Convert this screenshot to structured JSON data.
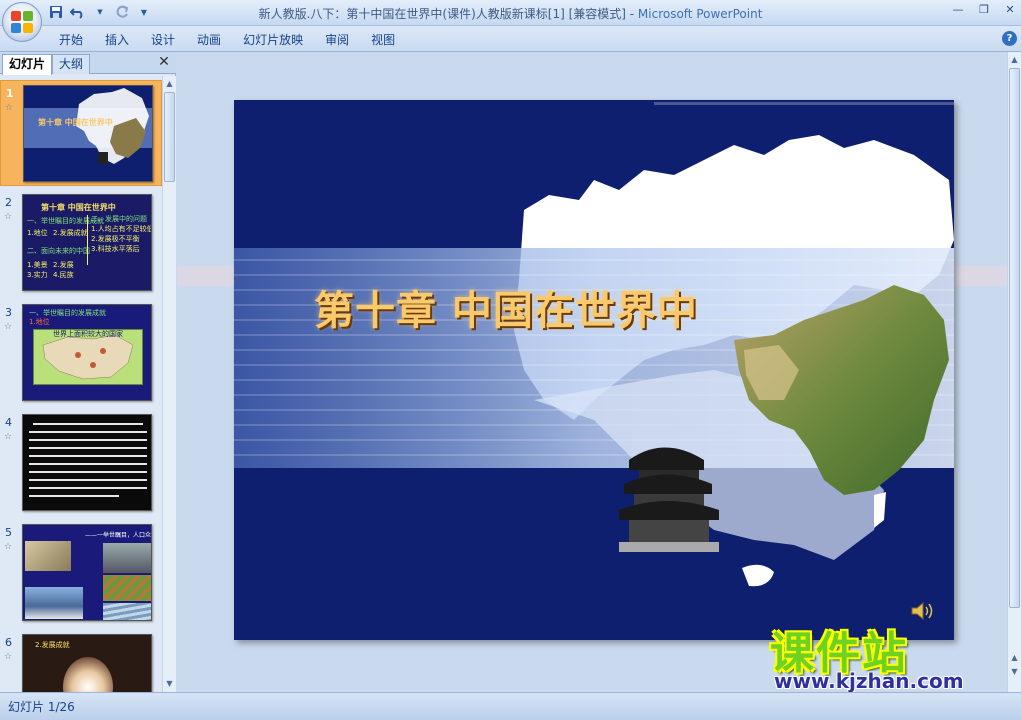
{
  "window": {
    "title": "新人教版.八下：第十中国在世界中(课件)人教版新课标[1] [兼容模式]",
    "separator": " - ",
    "app_name": "Microsoft PowerPoint"
  },
  "quick_access": {
    "icons": [
      "save-icon",
      "undo-icon",
      "redo-icon",
      "customize-icon"
    ]
  },
  "ribbon": {
    "tabs": [
      "开始",
      "插入",
      "设计",
      "动画",
      "幻灯片放映",
      "审阅",
      "视图"
    ]
  },
  "left_pane": {
    "tabs": {
      "slides": "幻灯片",
      "outline": "大纲"
    },
    "slides": [
      {
        "number": "1",
        "star": "☆",
        "selected": true,
        "title": "第十章 中国在世界中"
      },
      {
        "number": "2",
        "star": "☆",
        "selected": false,
        "title": "第十章 中国在世界中",
        "lines": [
          "一、举世瞩目的发展成就",
          "二、发展中的问题",
          "1.地位",
          "2.发展成就",
          "二、面向未来的中国",
          "1.人均占有不足较低",
          "2.发展极不平衡",
          "3.科技水平落后",
          "1.美景",
          "2.发展",
          "3.实力",
          "4.民族"
        ]
      },
      {
        "number": "3",
        "star": "☆",
        "selected": false,
        "title": "一、举世瞩目的发展成就",
        "subtitle": "1.地位",
        "map_title": "世界上面积较大的国家"
      },
      {
        "number": "4",
        "star": "☆",
        "selected": false
      },
      {
        "number": "5",
        "star": "☆",
        "selected": false,
        "caption": "——一举世瞩目，人口众多"
      },
      {
        "number": "6",
        "star": "☆",
        "selected": false,
        "title": "2.发展成就"
      }
    ]
  },
  "slide": {
    "title": "第十章 中国在世界中"
  },
  "watermark": {
    "text": "课件站",
    "url": "www.kjzhan.com"
  },
  "status": {
    "slide_indicator": "幻灯片 1/26"
  }
}
